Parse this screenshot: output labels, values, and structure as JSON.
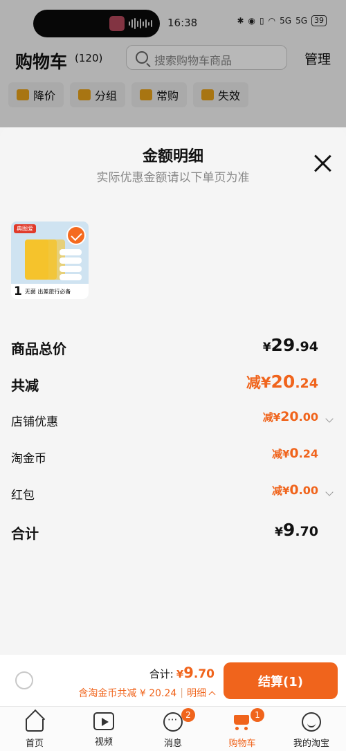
{
  "status_bar": {
    "time": "16:38",
    "signal_1": "5G",
    "signal_2": "5G",
    "battery": "39",
    "icons": [
      "bluetooth-icon",
      "location-icon",
      "vibrate-icon",
      "wifi-icon",
      "signal-icon",
      "battery-icon"
    ]
  },
  "cart_header": {
    "title": "购物车",
    "count": "(120)",
    "search_placeholder": "搜索购物车商品",
    "manage_label": "管理",
    "filters": [
      {
        "label": "降价",
        "icon": "price-drop-icon"
      },
      {
        "label": "分组",
        "icon": "folder-icon"
      },
      {
        "label": "常购",
        "icon": "cart-icon"
      },
      {
        "label": "失效",
        "icon": "invalid-icon"
      }
    ]
  },
  "sheet": {
    "title": "金额明细",
    "subtitle": "实际优惠金额请以下单页为准",
    "product": {
      "tag": "典图爱",
      "qty": "1",
      "caption": "无菌 出差旅行必备",
      "selected": true
    },
    "rows": {
      "total_price": {
        "label": "商品总价",
        "currency": "¥",
        "int": "29",
        "dec": ".94"
      },
      "total_discount": {
        "label": "共减",
        "prefix": "减¥",
        "int": "20",
        "dec": ".24"
      },
      "shop_discount": {
        "label": "店铺优惠",
        "prefix": "减¥",
        "int": "20",
        "dec": ".00"
      },
      "taojinbi": {
        "label": "淘金币",
        "prefix": "减¥",
        "int": "0",
        "dec": ".24"
      },
      "red_packet": {
        "label": "红包",
        "prefix": "减¥",
        "int": "0",
        "dec": ".00"
      },
      "sum": {
        "label": "合计",
        "currency": "¥",
        "int": "9",
        "dec": ".70"
      }
    }
  },
  "bottom_bar": {
    "total_label": "合计:",
    "total_currency": "¥",
    "total_int": "9",
    "total_dec": ".70",
    "discount_text": "含淘金币共减 ¥ 20.24",
    "separator": "|",
    "detail_label": "明细",
    "checkout_label": "结算(1)"
  },
  "tabbar": {
    "tabs": [
      {
        "label": "首页",
        "icon": "home-icon",
        "badge": ""
      },
      {
        "label": "视频",
        "icon": "video-icon",
        "badge": ""
      },
      {
        "label": "消息",
        "icon": "message-icon",
        "badge": "2"
      },
      {
        "label": "购物车",
        "icon": "cart-icon",
        "badge": "1",
        "active": true
      },
      {
        "label": "我的淘宝",
        "icon": "profile-icon",
        "badge": ""
      }
    ]
  },
  "colors": {
    "accent": "#f0641c",
    "sheet_bg": "#f5f5f5",
    "chip_icon": "#e9a31a"
  }
}
